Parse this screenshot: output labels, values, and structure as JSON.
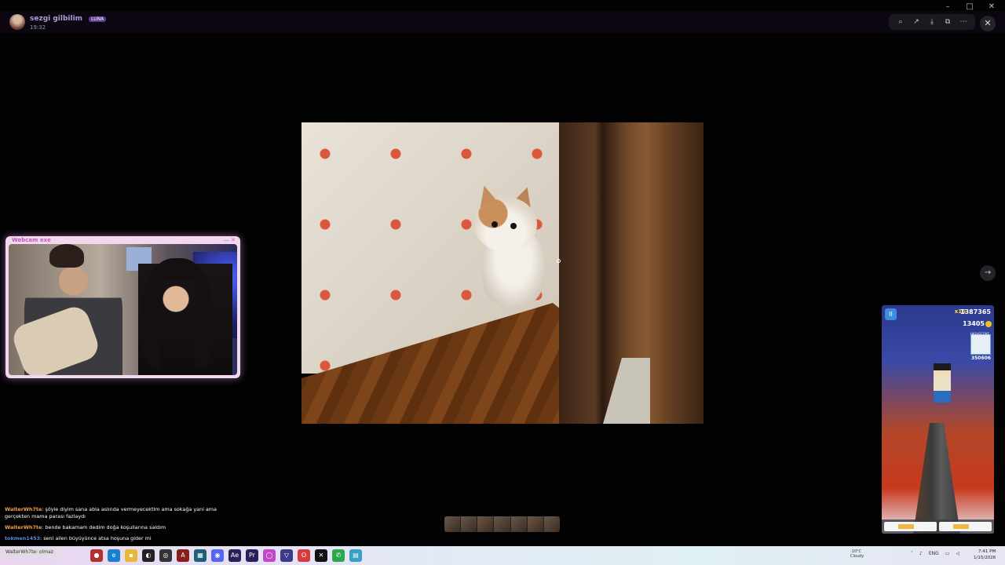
{
  "window": {
    "minimize": "–",
    "maximize": "□",
    "close": "✕"
  },
  "viewer": {
    "user_name": "sezgi gilbilim",
    "user_tag": "LUNA",
    "time": "19:32",
    "tools": [
      "zoom-icon",
      "share-icon",
      "download-icon",
      "open-icon",
      "more-icon"
    ],
    "close": "✕",
    "next": "→"
  },
  "webcam": {
    "title": "Webcam exe",
    "buttons": "— ✕"
  },
  "game": {
    "pause": "II",
    "multiplier": "x15",
    "score": "1387365",
    "coins": "13405",
    "highscore_label": "HIGHSCORE",
    "highscore": "350606"
  },
  "chat": [
    {
      "user": "WalterWh7te",
      "text": "şöyle diyim sana abla aslında vermeyecektim ama sokağa yani ama gerçekten mama parası fazlaydı"
    },
    {
      "user": "WalterWh7te",
      "text": "bende bakamam dedim doğa koşullarına saldım"
    },
    {
      "user": "tokmen1453",
      "text": "seni ailen büyüyünce atsa hoşuna gider mi"
    }
  ],
  "taskbar": {
    "search": "WalterWh7te: olmaz",
    "weather_temp": "-10°C",
    "weather_desc": "Cloudy",
    "lang": "ENG",
    "time": "7:41 PM",
    "date": "1/15/2026"
  }
}
